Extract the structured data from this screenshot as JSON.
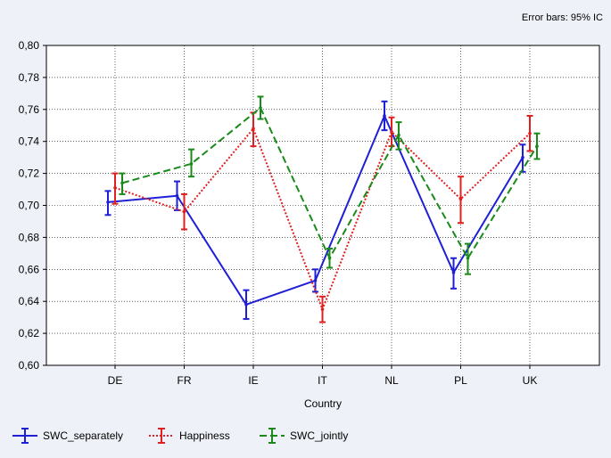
{
  "chart_data": {
    "type": "line",
    "note": "Error bars: 95% IC",
    "xlabel": "Country",
    "ylabel": "",
    "categories": [
      "DE",
      "FR",
      "IE",
      "IT",
      "NL",
      "PL",
      "UK"
    ],
    "ylim": [
      0.6,
      0.8
    ],
    "yticks": [
      "0,80",
      "0,78",
      "0,76",
      "0,74",
      "0,72",
      "0,70",
      "0,68",
      "0,66",
      "0,64",
      "0,62",
      "0,60"
    ],
    "ytick_values": [
      0.8,
      0.78,
      0.76,
      0.74,
      0.72,
      0.7,
      0.68,
      0.66,
      0.64,
      0.62,
      0.6
    ],
    "grid": true,
    "legend": "bottom",
    "series": [
      {
        "name": "SWC_separately",
        "color": "#1f1fd6",
        "style": "solid",
        "values": [
          0.702,
          0.706,
          0.638,
          0.653,
          0.756,
          0.658,
          0.73
        ],
        "err_low": [
          0.694,
          0.697,
          0.629,
          0.646,
          0.747,
          0.648,
          0.721
        ],
        "err_high": [
          0.709,
          0.715,
          0.647,
          0.66,
          0.765,
          0.667,
          0.738
        ]
      },
      {
        "name": "Happiness",
        "color": "#e02020",
        "style": "dotted",
        "values": [
          0.711,
          0.696,
          0.748,
          0.635,
          0.746,
          0.704,
          0.745
        ],
        "err_low": [
          0.701,
          0.685,
          0.737,
          0.627,
          0.737,
          0.689,
          0.734
        ],
        "err_high": [
          0.72,
          0.707,
          0.758,
          0.643,
          0.755,
          0.718,
          0.756
        ]
      },
      {
        "name": "SWC_jointly",
        "color": "#1a8a1a",
        "style": "dashed",
        "values": [
          0.714,
          0.726,
          0.761,
          0.667,
          0.744,
          0.667,
          0.737
        ],
        "err_low": [
          0.707,
          0.718,
          0.754,
          0.661,
          0.735,
          0.657,
          0.729
        ],
        "err_high": [
          0.72,
          0.735,
          0.768,
          0.673,
          0.752,
          0.676,
          0.745
        ]
      }
    ]
  }
}
